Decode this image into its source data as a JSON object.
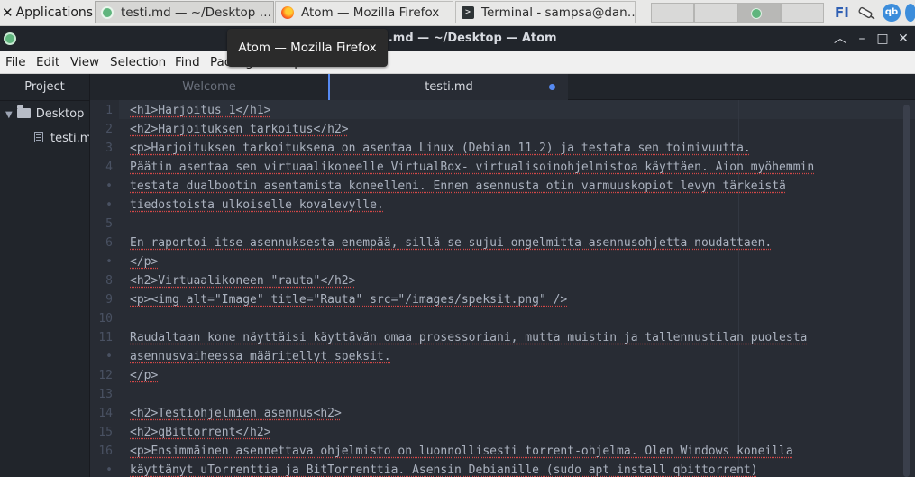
{
  "panel": {
    "applications_label": "Applications",
    "tasks": [
      {
        "label": "testi.md — ~/Desktop …",
        "icon": "atom-icon"
      },
      {
        "label": "Atom — Mozilla Firefox",
        "icon": "firefox-icon"
      },
      {
        "label": "Terminal - sampsa@dan…",
        "icon": "terminal-icon"
      }
    ],
    "keyboard_layout": "FI",
    "qb_label": "qb"
  },
  "window": {
    "title": "testi.md — ~/Desktop — Atom",
    "tooltip": "Atom — Mozilla Firefox",
    "menu": [
      "File",
      "Edit",
      "View",
      "Selection",
      "Find",
      "Packages",
      "Help"
    ]
  },
  "tree": {
    "header": "Project",
    "folder": "Desktop",
    "file": "testi.m"
  },
  "tabs": [
    {
      "label": "Welcome",
      "active": false
    },
    {
      "label": "testi.md",
      "active": true,
      "modified": true
    }
  ],
  "editor": {
    "gutter": [
      "1",
      "2",
      "3",
      "4",
      "•",
      "•",
      "5",
      "6",
      "•",
      "8",
      "9",
      "10",
      "11",
      "•",
      "12",
      "13",
      "14",
      "15",
      "16",
      "•"
    ],
    "lines": [
      "<h1>Harjoitus 1</h1>",
      "<h2>Harjoituksen tarkoitus</h2>",
      "<p>Harjoituksen tarkoituksena on asentaa Linux (Debian 11.2) ja testata sen toimivuutta.",
      "Päätin asentaa sen virtuaalikoneelle VirtualBox- virtualisoinohjelmistoa käyttäen. Aion myöhemmin",
      "testata dualbootin asentamista koneelleni. Ennen asennusta otin varmuuskopiot levyn tärkeistä",
      "tiedostoista ulkoiselle kovalevylle.",
      "",
      "En raportoi itse asennuksesta enempää, sillä se sujui ongelmitta asennusohjetta noudattaen.",
      "</p>",
      "<h2>Virtuaalikoneen \"rauta\"</h2>",
      "<p><img alt=\"Image\" title=\"Rauta\" src=\"/images/speksit.png\" />",
      "",
      "Raudaltaan kone näyttäisi käyttävän omaa prosessoriani, mutta muistin ja tallennustilan puolesta",
      "asennusvaiheessa määritellyt speksit.",
      "</p>",
      "",
      "<h2>Testiohjelmien asennus<h2>",
      "<h2>qBittorrent</h2>",
      "<p>Ensimmäinen asennettava ohjelmisto on luonnollisesti torrent-ohjelma. Olen Windows koneilla",
      "käyttänyt uTorrenttia ja BitTorrenttia. Asensin Debianille (sudo apt install qbittorrent)"
    ]
  },
  "colors": {
    "editor_bg": "#282c34",
    "panel_bg": "#e8e8e7",
    "accent": "#568af2",
    "spell_error": "#d44848"
  }
}
